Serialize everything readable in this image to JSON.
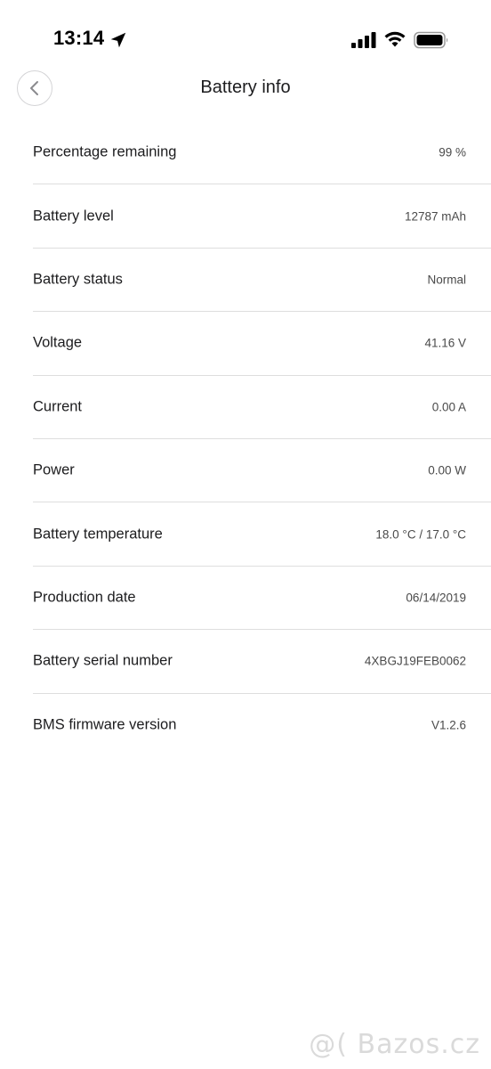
{
  "status_bar": {
    "time": "13:14"
  },
  "header": {
    "title": "Battery info"
  },
  "rows": [
    {
      "label": "Percentage remaining",
      "value": "99 %"
    },
    {
      "label": "Battery level",
      "value": "12787 mAh"
    },
    {
      "label": "Battery status",
      "value": "Normal"
    },
    {
      "label": "Voltage",
      "value": "41.16 V"
    },
    {
      "label": "Current",
      "value": "0.00 A"
    },
    {
      "label": "Power",
      "value": "0.00 W"
    },
    {
      "label": "Battery temperature",
      "value": "18.0 °C / 17.0 °C"
    },
    {
      "label": "Production date",
      "value": "06/14/2019"
    },
    {
      "label": "Battery serial number",
      "value": "4XBGJ19FEB0062"
    },
    {
      "label": "BMS firmware version",
      "value": "V1.2.6"
    }
  ],
  "watermark": "@( Bazos.cz",
  "icons": {
    "location": "location-arrow-icon",
    "signal": "cellular-signal-icon",
    "wifi": "wifi-icon",
    "battery": "battery-icon",
    "back": "chevron-left-icon"
  }
}
